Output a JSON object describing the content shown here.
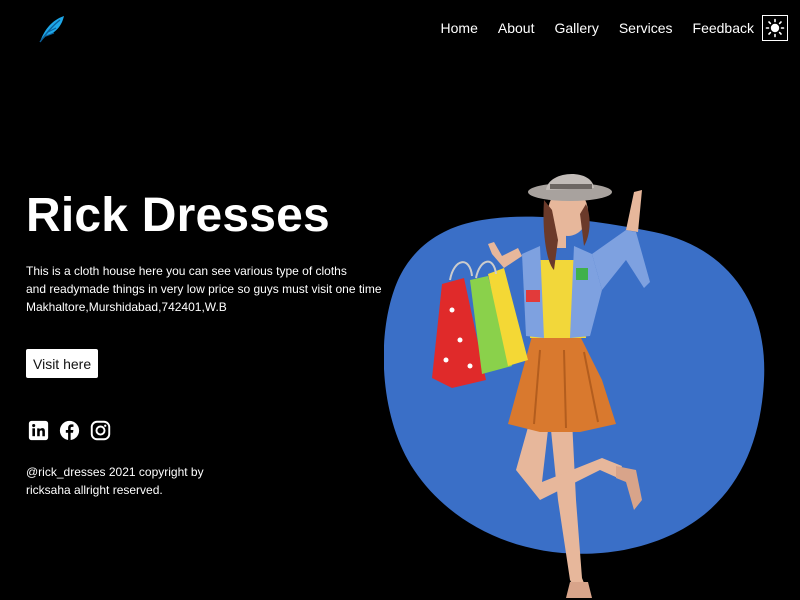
{
  "header": {
    "logo_icon": "feather-icon",
    "nav": [
      "Home",
      "About",
      "Gallery",
      "Services",
      "Feedback"
    ],
    "theme_toggle_icon": "sun-icon"
  },
  "hero": {
    "title": "Rick Dresses",
    "description_lines": [
      "This is a cloth house here you can see various type of cloths",
      "and readymade things in very low price so guys must visit one time",
      "Makhaltore,Murshidabad,742401,W.B"
    ],
    "cta_label": "Visit here",
    "socials": [
      "linkedin-icon",
      "facebook-icon",
      "instagram-icon"
    ],
    "copyright_lines": [
      "@rick_dresses 2021 copyright by",
      "ricksaha allright reserved."
    ],
    "image": "woman-with-shopping-bags",
    "blob_color": "#3a6fc7"
  },
  "colors": {
    "background": "#000000",
    "text": "#ffffff",
    "logo": "#1ea7e8"
  }
}
